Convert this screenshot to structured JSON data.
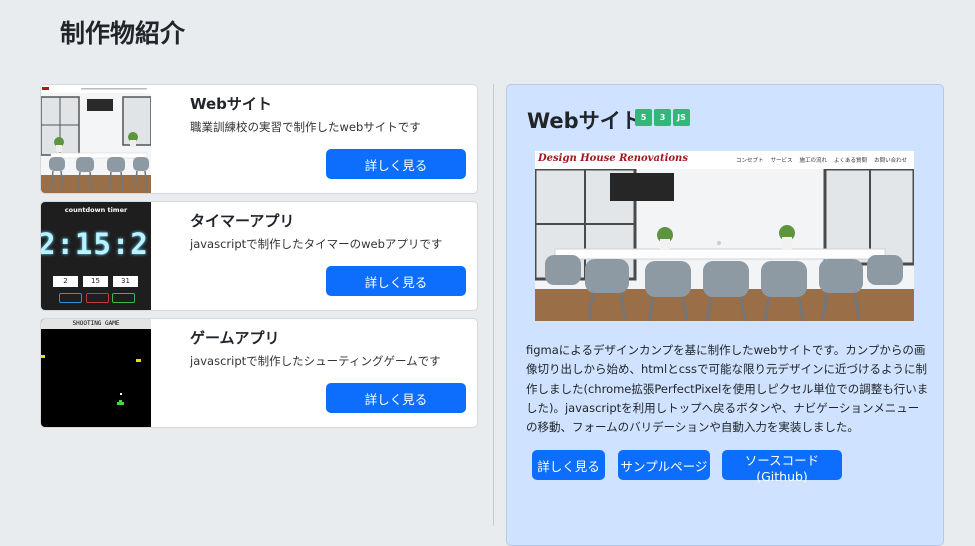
{
  "page_title": "制作物紹介",
  "cards": [
    {
      "title": "Webサイト",
      "desc": "職業訓練校の実習で制作したwebサイトです",
      "button": "詳しく見る"
    },
    {
      "title": "タイマーアプリ",
      "desc": "javascriptで制作したタイマーのwebアプリです",
      "button": "詳しく見る"
    },
    {
      "title": "ゲームアプリ",
      "desc": "javascriptで制作したシューティングゲームです",
      "button": "詳しく見る"
    }
  ],
  "timer_thumb": {
    "heading": "countdown timer",
    "display": "2:15:2",
    "inputs": [
      "2",
      "15",
      "31"
    ]
  },
  "game_thumb": {
    "heading": "SHOOTING GAME"
  },
  "detail": {
    "title": "Webサイト",
    "tech_icons": [
      {
        "icon": "html5-icon",
        "label": "5",
        "color": "#31b77a"
      },
      {
        "icon": "css3-icon",
        "label": "3",
        "color": "#31b77a"
      },
      {
        "icon": "javascript-icon",
        "label": "JS",
        "color": "#31b77a"
      }
    ],
    "site_brand": "Design House Renovations",
    "site_nav": [
      "コンセプト",
      "サービス",
      "施工の流れ",
      "よくある質問",
      "お問い合わせ"
    ],
    "description": "figmaによるデザインカンプを基に制作したwebサイトです。カンプからの画像切り出しから始め、htmlとcssで可能な限り元デザインに近づけるように制作しました(chrome拡張PerfectPixelを使用しピクセル単位での調整も行いました)。javascriptを利用しトップへ戻るボタンや、ナビゲーションメニューの移動、フォームのバリデーションや自動入力を実装しました。",
    "buttons": {
      "details": "詳しく見る",
      "sample": "サンプルページ",
      "source": "ソースコード(Github)"
    }
  },
  "colors": {
    "accent": "#0d6efd",
    "detail_bg": "#cfe2ff",
    "page_bg": "#e9ecef"
  }
}
